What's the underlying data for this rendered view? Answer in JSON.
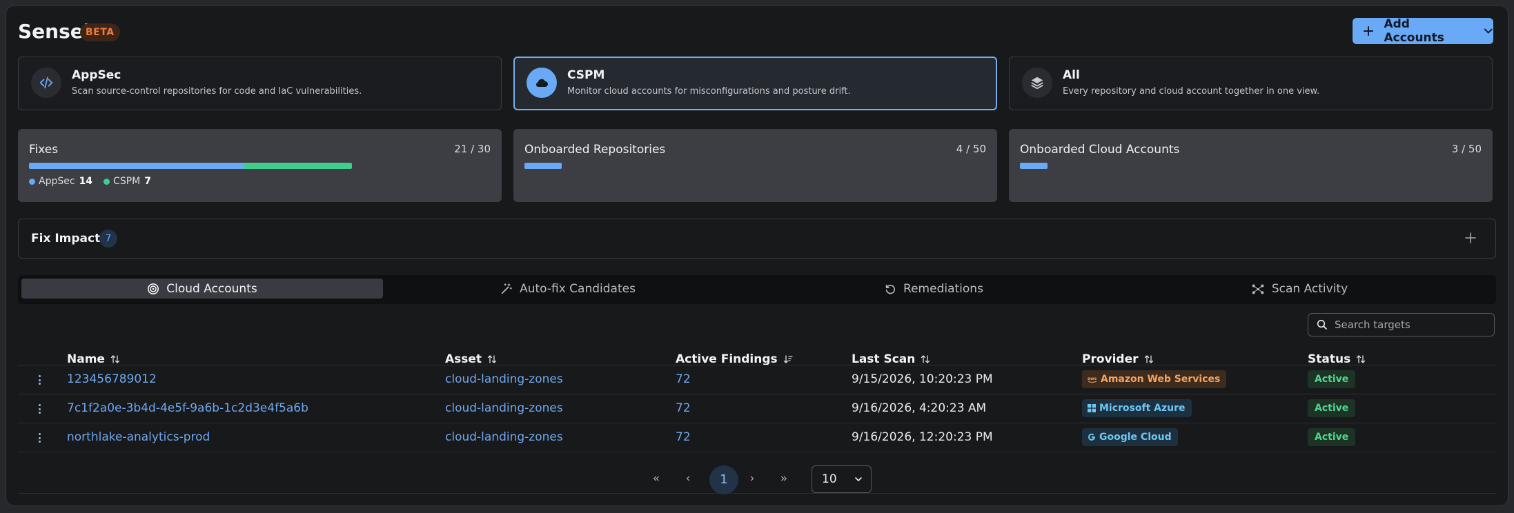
{
  "app": {
    "title": "Sensei",
    "badge": "BETA"
  },
  "header": {
    "add_button": "Add Accounts"
  },
  "modes": [
    {
      "name": "AppSec",
      "desc": "Scan source-control repositories for code and IaC vulnerabilities.",
      "icon": "code-icon"
    },
    {
      "name": "CSPM",
      "desc": "Monitor cloud accounts for misconfigurations and posture drift.",
      "icon": "cloud-icon",
      "active": true
    },
    {
      "name": "All",
      "desc": "Every repository and cloud account together in one view.",
      "icon": "layers-icon"
    }
  ],
  "stats": {
    "fixes": {
      "label": "Fixes",
      "count": "21 / 30",
      "appsec": 14,
      "cspm": 7,
      "total": 30,
      "appsec_label": "AppSec",
      "cspm_label": "CSPM",
      "appsec_value": "14",
      "cspm_value": "7"
    },
    "repos": {
      "label": "Onboarded Repositories",
      "count": "4 / 50",
      "value": 4,
      "total": 50
    },
    "clouds": {
      "label": "Onboarded Cloud Accounts",
      "count": "3 / 50",
      "value": 3,
      "total": 50
    }
  },
  "impact": {
    "label": "Fix Impact",
    "count": "7"
  },
  "tabs": [
    {
      "label": "Cloud Accounts",
      "icon": "target-icon",
      "active": true
    },
    {
      "label": "Auto-fix Candidates",
      "icon": "magic-wand-icon"
    },
    {
      "label": "Remediations",
      "icon": "undo-icon"
    },
    {
      "label": "Scan Activity",
      "icon": "nodes-icon"
    }
  ],
  "search": {
    "placeholder": "Search targets"
  },
  "table": {
    "columns": [
      "Name",
      "Asset",
      "Active Findings",
      "Last Scan",
      "Provider",
      "Status"
    ],
    "rows": [
      {
        "name": "123456789012",
        "asset": "cloud-landing-zones",
        "findings": "72",
        "last_scan": "9/15/2026, 10:20:23 PM",
        "provider": "Amazon Web Services",
        "status": "Active"
      },
      {
        "name": "7c1f2a0e-3b4d-4e5f-9a6b-1c2d3e4f5a6b",
        "asset": "cloud-landing-zones",
        "findings": "72",
        "last_scan": "9/16/2026, 4:20:23 AM",
        "provider": "Microsoft Azure",
        "status": "Active"
      },
      {
        "name": "northlake-analytics-prod",
        "asset": "cloud-landing-zones",
        "findings": "72",
        "last_scan": "9/16/2026, 12:20:23 PM",
        "provider": "Google Cloud",
        "status": "Active"
      }
    ]
  },
  "pagination": {
    "current": "1",
    "page_size": "10",
    "first": "«",
    "prev": "‹",
    "next": "›",
    "last": "»"
  },
  "colors": {
    "accent": "#6aa9f5",
    "success": "#3ecf8e",
    "beta": "#f07a3c"
  }
}
